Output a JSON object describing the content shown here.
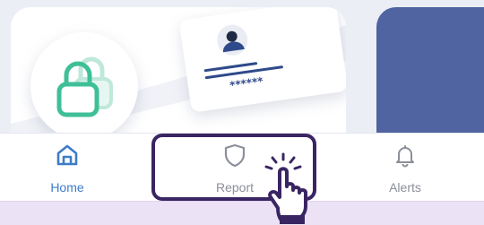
{
  "nav": {
    "items": [
      {
        "label": "Home",
        "icon": "home-icon",
        "active": true
      },
      {
        "label": "Report",
        "icon": "shield-icon",
        "active": false
      },
      {
        "label": "Alerts",
        "icon": "bell-icon",
        "active": false
      }
    ]
  },
  "colors": {
    "active": "#3d7cc9",
    "inactive": "#8b8f99",
    "highlight": "#3a2563",
    "lock": "#3fbf97",
    "blue_card": "#4f64a0"
  }
}
